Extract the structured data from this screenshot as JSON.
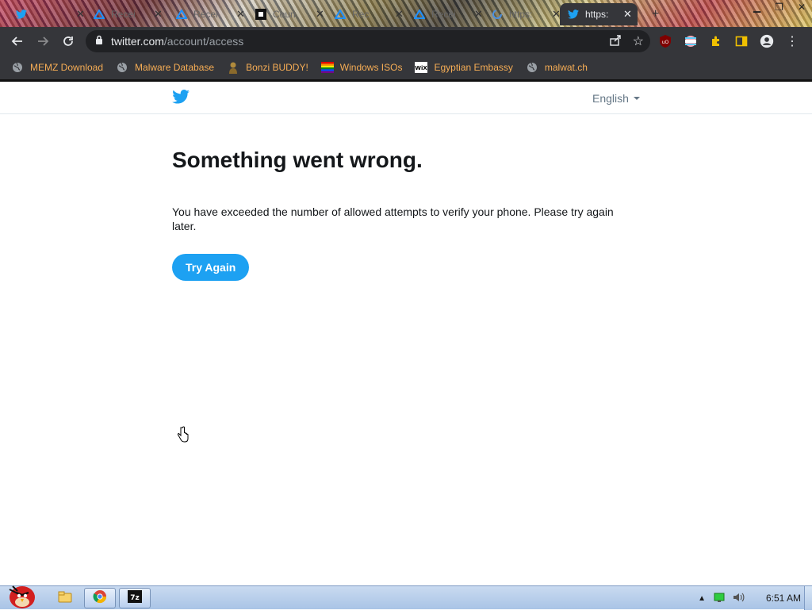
{
  "tabs": [
    {
      "title": "",
      "active": false
    },
    {
      "title": "Recei",
      "active": false
    },
    {
      "title": "Recei",
      "active": false
    },
    {
      "title": "Coun",
      "active": false
    },
    {
      "title": "Rec",
      "active": false
    },
    {
      "title": "Recei",
      "active": false
    },
    {
      "title": "https:",
      "active": false
    },
    {
      "title": "https:",
      "active": true
    }
  ],
  "toolbar": {
    "url_host": "twitter.com",
    "url_path": "/account/access"
  },
  "bookmarks": [
    {
      "label": "MEMZ Download",
      "icon": "globe-icon"
    },
    {
      "label": "Malware Database",
      "icon": "globe-icon"
    },
    {
      "label": "Bonzi BUDDY!",
      "icon": "bonzi-icon"
    },
    {
      "label": "Windows ISOs",
      "icon": "rainbow-flag-icon"
    },
    {
      "label": "Egyptian Embassy",
      "icon": "wix-icon"
    },
    {
      "label": "malwat.ch",
      "icon": "globe-icon"
    }
  ],
  "page": {
    "language": "English",
    "heading": "Something went wrong.",
    "message": "You have exceeded the number of allowed attempts to verify your phone. Please try again later.",
    "button_label": "Try Again"
  },
  "taskbar": {
    "clock": "6:51 AM"
  },
  "colors": {
    "twitter_blue": "#1da1f2",
    "chrome_dark": "#35363a",
    "bookmark_text": "#f6ad55"
  }
}
